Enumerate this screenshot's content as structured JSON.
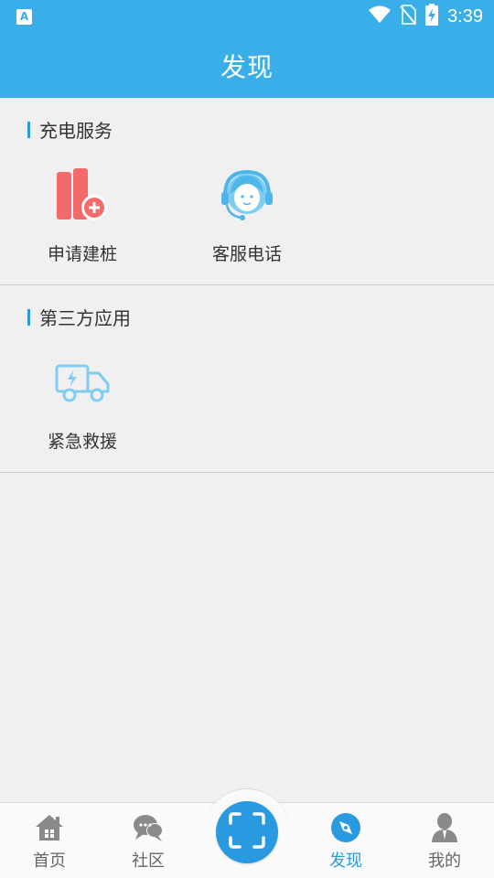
{
  "status_bar": {
    "time": "3:39",
    "left_badge": "A",
    "icons": [
      "wifi-icon",
      "no-sim-icon",
      "battery-charging-icon"
    ]
  },
  "header": {
    "title": "发现"
  },
  "sections": [
    {
      "title": "充电服务",
      "items": [
        {
          "label": "申请建桩",
          "icon": "apply-charging-pile-icon"
        },
        {
          "label": "客服电话",
          "icon": "customer-service-headset-icon"
        }
      ]
    },
    {
      "title": "第三方应用",
      "items": [
        {
          "label": "紧急救援",
          "icon": "rescue-truck-icon"
        }
      ]
    }
  ],
  "tabbar": {
    "tabs": [
      {
        "label": "首页",
        "icon": "home-icon",
        "active": false
      },
      {
        "label": "社区",
        "icon": "chat-bubbles-icon",
        "active": false
      },
      {
        "label": "",
        "icon": "scan-icon",
        "active": false
      },
      {
        "label": "发现",
        "icon": "compass-icon",
        "active": true
      },
      {
        "label": "我的",
        "icon": "user-icon",
        "active": false
      }
    ]
  },
  "colors": {
    "primary": "#3aaee8",
    "accent": "#2a9ae0",
    "background": "#f0f0f0",
    "icon_red": "#f26a6a",
    "icon_light_blue": "#7fcdf3",
    "tab_inactive": "#8a8a8a"
  }
}
